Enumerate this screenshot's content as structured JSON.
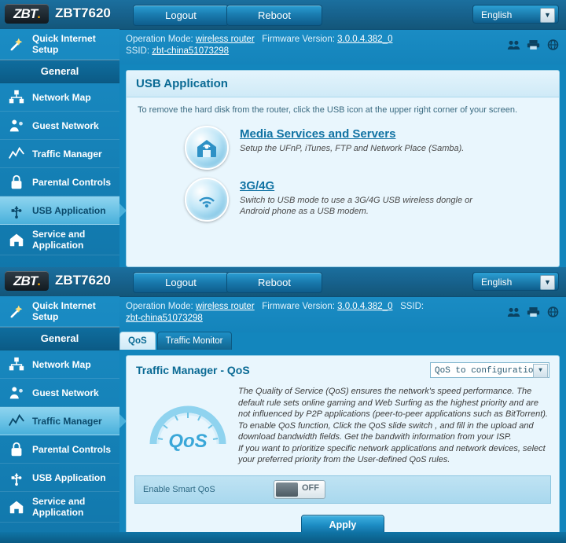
{
  "brand": {
    "logo_text": "ZBT",
    "model": "ZBT7620"
  },
  "topbar": {
    "logout_label": "Logout",
    "reboot_label": "Reboot",
    "language_value": "English",
    "dropdown_arrow": "▼"
  },
  "info": {
    "operation_mode_label": "Operation Mode:",
    "operation_mode_value": "wireless router",
    "firmware_label": "Firmware Version:",
    "firmware_value": "3.0.0.4.382_0",
    "ssid_label": "SSID:",
    "ssid_value": "zbt-china51073298",
    "icons": [
      "users-icon",
      "printer-icon",
      "globe-icon"
    ]
  },
  "sidebar": {
    "top_items": [
      {
        "label": "Quick Internet Setup",
        "icon": "wizard-icon",
        "active": false
      },
      {
        "label": "General",
        "icon": "",
        "header": true
      },
      {
        "label": "Network Map",
        "icon": "network-map-icon",
        "active": false
      },
      {
        "label": "Guest Network",
        "icon": "guest-network-icon",
        "active": false
      },
      {
        "label": "Traffic Manager",
        "icon": "traffic-manager-icon",
        "active": false
      },
      {
        "label": "Parental Controls",
        "icon": "parental-controls-icon",
        "active": false
      },
      {
        "label": "USB Application",
        "icon": "usb-application-icon",
        "active": true
      },
      {
        "label": "Service and Application",
        "icon": "service-application-icon",
        "active": false
      }
    ],
    "bottom_items": [
      {
        "label": "Quick Internet Setup",
        "icon": "wizard-icon",
        "active": false
      },
      {
        "label": "General",
        "icon": "",
        "header": true
      },
      {
        "label": "Network Map",
        "icon": "network-map-icon",
        "active": false
      },
      {
        "label": "Guest Network",
        "icon": "guest-network-icon",
        "active": false
      },
      {
        "label": "Traffic Manager",
        "icon": "traffic-manager-icon",
        "active": true
      },
      {
        "label": "Parental Controls",
        "icon": "parental-controls-icon",
        "active": false
      },
      {
        "label": "USB Application",
        "icon": "usb-application-icon",
        "active": false
      },
      {
        "label": "Service and Application",
        "icon": "service-application-icon",
        "active": false
      }
    ]
  },
  "usb_page": {
    "title": "USB Application",
    "hint": "To remove the hard disk from the router, click the USB icon at the upper right corner of your screen.",
    "apps": [
      {
        "title": "Media Services and Servers",
        "desc": "Setup the UFnP, iTunes, FTP and Network Place (Samba).",
        "icon": "media-server-icon"
      },
      {
        "title": "3G/4G",
        "desc": "Switch to USB mode to use a 3G/4G USB wireless dongle or Android phone as a USB modem.",
        "icon": "3g4g-icon"
      }
    ]
  },
  "qos_page": {
    "tabs": [
      {
        "label": "QoS",
        "active": true
      },
      {
        "label": "Traffic Monitor",
        "active": false
      }
    ],
    "title": "Traffic Manager - QoS",
    "select_value": "QoS to configuration",
    "select_arrow": "▼",
    "gauge_label": "QoS",
    "description": "The Quality of Service (QoS) ensures the network's speed performance. The default rule sets online gaming and Web Surfing as the highest priority and are not influenced by P2P applications (peer-to-peer applications such as BitTorrent). To enable QoS function, Click the QoS slide switch , and fill in the upload and download bandwidth fields. Get the bandwith information from your ISP.\nIf you want to prioritize specific network applications and network devices, select your preferred priority from the User-defined QoS rules.",
    "smart_qos_label": "Enable Smart QoS",
    "smart_qos_state": "OFF",
    "apply_label": "Apply"
  },
  "colors": {
    "accent": "#1386bd",
    "panel_bg": "#e9f6fd",
    "link": "#1072a3",
    "sidebar_active": "#6cc3e6"
  }
}
